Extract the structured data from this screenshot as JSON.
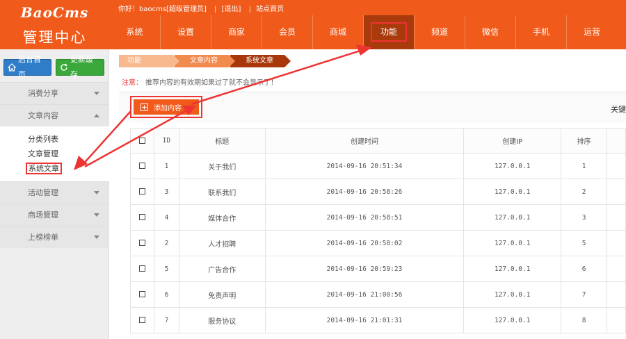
{
  "brand": {
    "logo_text": "BaoCms",
    "subtitle": "管理中心"
  },
  "topbar": {
    "greeting": "你好！baocms[超级管理员]",
    "logout": "[退出]",
    "site_home": "站点首页"
  },
  "nav": [
    {
      "label": "系统"
    },
    {
      "label": "设置"
    },
    {
      "label": "商家"
    },
    {
      "label": "会员"
    },
    {
      "label": "商城"
    },
    {
      "label": "功能",
      "active": true
    },
    {
      "label": "频道"
    },
    {
      "label": "微信"
    },
    {
      "label": "手机"
    },
    {
      "label": "运营"
    }
  ],
  "sidebar": {
    "home_button": "后台首页",
    "refresh_button": "更新缓存",
    "groups": [
      {
        "label": "消费分享"
      },
      {
        "label": "文章内容",
        "expanded": true,
        "items": [
          "分类列表",
          "文章管理",
          "系统文章"
        ]
      },
      {
        "label": "活动管理"
      },
      {
        "label": "商场管理"
      },
      {
        "label": "上榜榜单"
      }
    ]
  },
  "breadcrumb": [
    "功能",
    "文章内容",
    "系统文章"
  ],
  "notice": {
    "label": "注意：",
    "text": "推荐内容的有效期如果过了就不会显示了！"
  },
  "toolbar": {
    "add_label": "添加内容",
    "keyword_label": "关键"
  },
  "table": {
    "headers": [
      "ID",
      "标题",
      "创建时间",
      "创建IP",
      "排序"
    ],
    "rows": [
      {
        "id": "1",
        "title": "关于我们",
        "time": "2014-09-16 20:51:34",
        "ip": "127.0.0.1",
        "order": "1"
      },
      {
        "id": "3",
        "title": "联系我们",
        "time": "2014-09-16 20:58:26",
        "ip": "127.0.0.1",
        "order": "2"
      },
      {
        "id": "4",
        "title": "媒体合作",
        "time": "2014-09-16 20:58:51",
        "ip": "127.0.0.1",
        "order": "3"
      },
      {
        "id": "2",
        "title": "人才招聘",
        "time": "2014-09-16 20:58:02",
        "ip": "127.0.0.1",
        "order": "5"
      },
      {
        "id": "5",
        "title": "广告合作",
        "time": "2014-09-16 20:59:23",
        "ip": "127.0.0.1",
        "order": "6"
      },
      {
        "id": "6",
        "title": "免责声明",
        "time": "2014-09-16 21:00:56",
        "ip": "127.0.0.1",
        "order": "7"
      },
      {
        "id": "7",
        "title": "服务协议",
        "time": "2014-09-16 21:01:31",
        "ip": "127.0.0.1",
        "order": "8"
      }
    ]
  },
  "colors": {
    "brand": "#f05a1a",
    "active_nav": "#a83a0b",
    "highlight": "#e33333"
  }
}
